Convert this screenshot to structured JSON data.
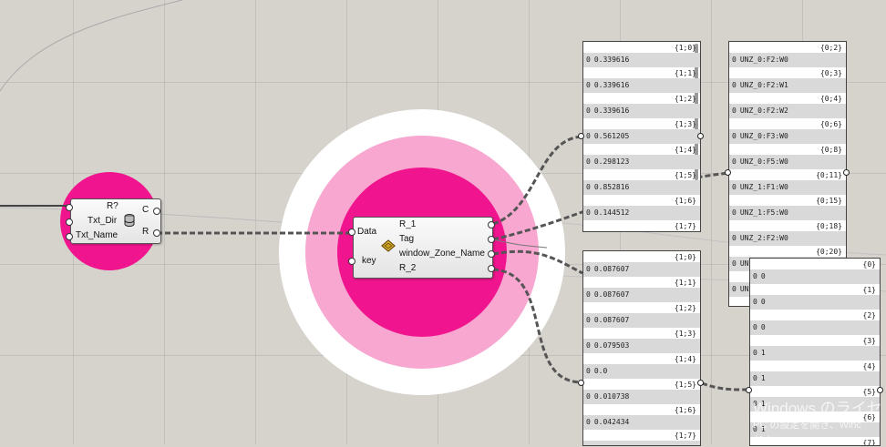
{
  "colors": {
    "background": "#d6d3cd",
    "group_pink": "#f0158e",
    "group_light": "#f7a7d0",
    "wire": "#555555"
  },
  "component_left": {
    "inputs": [
      "Txt_Dir",
      "Txt_Name"
    ],
    "input_top": "R?",
    "outputs": [
      "C",
      "R"
    ],
    "icon": "database-icon"
  },
  "component_center": {
    "inputs": [
      "Data",
      "key"
    ],
    "outputs": [
      "R_1",
      "Tag",
      "window_Zone_Name",
      "R_2"
    ],
    "icon": "tag-icon"
  },
  "panel_a": {
    "rows": [
      {
        "tag": "{1;0}",
        "idx": "0",
        "val": "0.339616"
      },
      {
        "tag": "{1;1}",
        "idx": "0",
        "val": "0.339616"
      },
      {
        "tag": "{1;2}",
        "idx": "0",
        "val": "0.339616"
      },
      {
        "tag": "{1;3}",
        "idx": "0",
        "val": "0.561205"
      },
      {
        "tag": "{1;4}",
        "idx": "0",
        "val": "0.298123"
      },
      {
        "tag": "{1;5}",
        "idx": "0",
        "val": "0.852816"
      },
      {
        "tag": "{1;6}",
        "idx": "0",
        "val": "0.144512"
      },
      {
        "tag": "{1;7}",
        "idx": "",
        "val": ""
      }
    ]
  },
  "panel_b": {
    "rows": [
      {
        "tag": "{0;2}",
        "idx": "0",
        "val": "UNZ_0:F2:W0"
      },
      {
        "tag": "{0;3}",
        "idx": "0",
        "val": "UNZ_0:F2:W1"
      },
      {
        "tag": "{0;4}",
        "idx": "0",
        "val": "UNZ_0:F2:W2"
      },
      {
        "tag": "{0;6}",
        "idx": "0",
        "val": "UNZ_0:F3:W0"
      },
      {
        "tag": "{0;8}",
        "idx": "0",
        "val": "UNZ_0:F5:W0"
      },
      {
        "tag": "{0;11}",
        "idx": "0",
        "val": "UNZ_1:F1:W0"
      },
      {
        "tag": "{0;15}",
        "idx": "0",
        "val": "UNZ_1:F5:W0"
      },
      {
        "tag": "{0;18}",
        "idx": "0",
        "val": "UNZ_2:F2:W0"
      },
      {
        "tag": "{0;20}",
        "idx": "0",
        "val": "UN"
      },
      {
        "tag": "",
        "idx": "0",
        "val": "UN"
      }
    ]
  },
  "panel_c": {
    "rows": [
      {
        "tag": "{1;0}",
        "idx": "0",
        "val": "0.087607"
      },
      {
        "tag": "{1;1}",
        "idx": "0",
        "val": "0.087607"
      },
      {
        "tag": "{1;2}",
        "idx": "0",
        "val": "0.087607"
      },
      {
        "tag": "{1;3}",
        "idx": "0",
        "val": "0.079503"
      },
      {
        "tag": "{1;4}",
        "idx": "0",
        "val": "0.0"
      },
      {
        "tag": "{1;5}",
        "idx": "0",
        "val": "0.010738"
      },
      {
        "tag": "{1;6}",
        "idx": "0",
        "val": "0.042434"
      },
      {
        "tag": "{1;7}",
        "idx": "",
        "val": ""
      }
    ]
  },
  "panel_d": {
    "rows": [
      {
        "tag": "{0}",
        "idx": "0",
        "val": "0"
      },
      {
        "tag": "{1}",
        "idx": "0",
        "val": "0"
      },
      {
        "tag": "{2}",
        "idx": "0",
        "val": "0"
      },
      {
        "tag": "{3}",
        "idx": "0",
        "val": "1"
      },
      {
        "tag": "{4}",
        "idx": "0",
        "val": "1"
      },
      {
        "tag": "{5}",
        "idx": "0",
        "val": "1"
      },
      {
        "tag": "{6}",
        "idx": "0",
        "val": "1"
      },
      {
        "tag": "{7}",
        "idx": "",
        "val": ""
      }
    ]
  },
  "watermark": {
    "line1": "Windows のライセ",
    "line2": "PC の設定を開き、Winc",
    "line3": "ださい。"
  }
}
